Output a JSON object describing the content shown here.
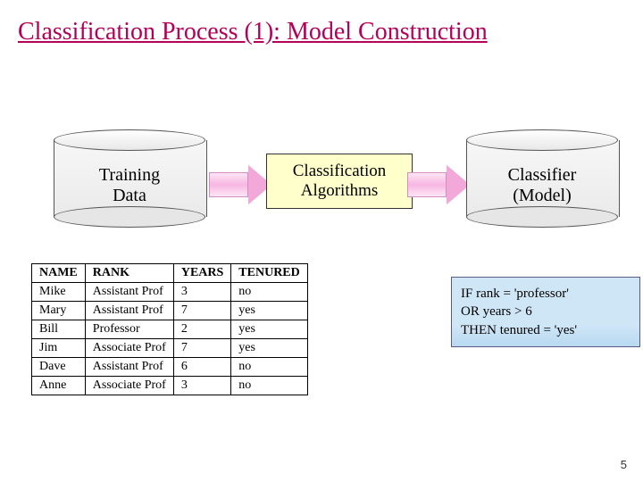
{
  "title": "Classification Process (1): Model Construction",
  "cylinder_left": {
    "label_l1": "Training",
    "label_l2": "Data"
  },
  "cylinder_right": {
    "label_l1": "Classifier",
    "label_l2": "(Model)"
  },
  "algo_box": {
    "l1": "Classification",
    "l2": "Algorithms"
  },
  "rule_box": {
    "l1": "IF rank = 'professor'",
    "l2": "OR years > 6",
    "l3": "THEN tenured = 'yes'"
  },
  "table": {
    "headers": [
      "NAME",
      "RANK",
      "YEARS",
      "TENURED"
    ],
    "rows": [
      [
        "Mike",
        "Assistant Prof",
        "3",
        "no"
      ],
      [
        "Mary",
        "Assistant Prof",
        "7",
        "yes"
      ],
      [
        "Bill",
        "Professor",
        "2",
        "yes"
      ],
      [
        "Jim",
        "Associate Prof",
        "7",
        "yes"
      ],
      [
        "Dave",
        "Assistant Prof",
        "6",
        "no"
      ],
      [
        "Anne",
        "Associate Prof",
        "3",
        "no"
      ]
    ]
  },
  "page_number": "5",
  "colors": {
    "title": "#b50059",
    "algo_bg": "#ffffcc",
    "rule_bg": "#cfe6f7",
    "arrow": "#f2a8d8"
  }
}
